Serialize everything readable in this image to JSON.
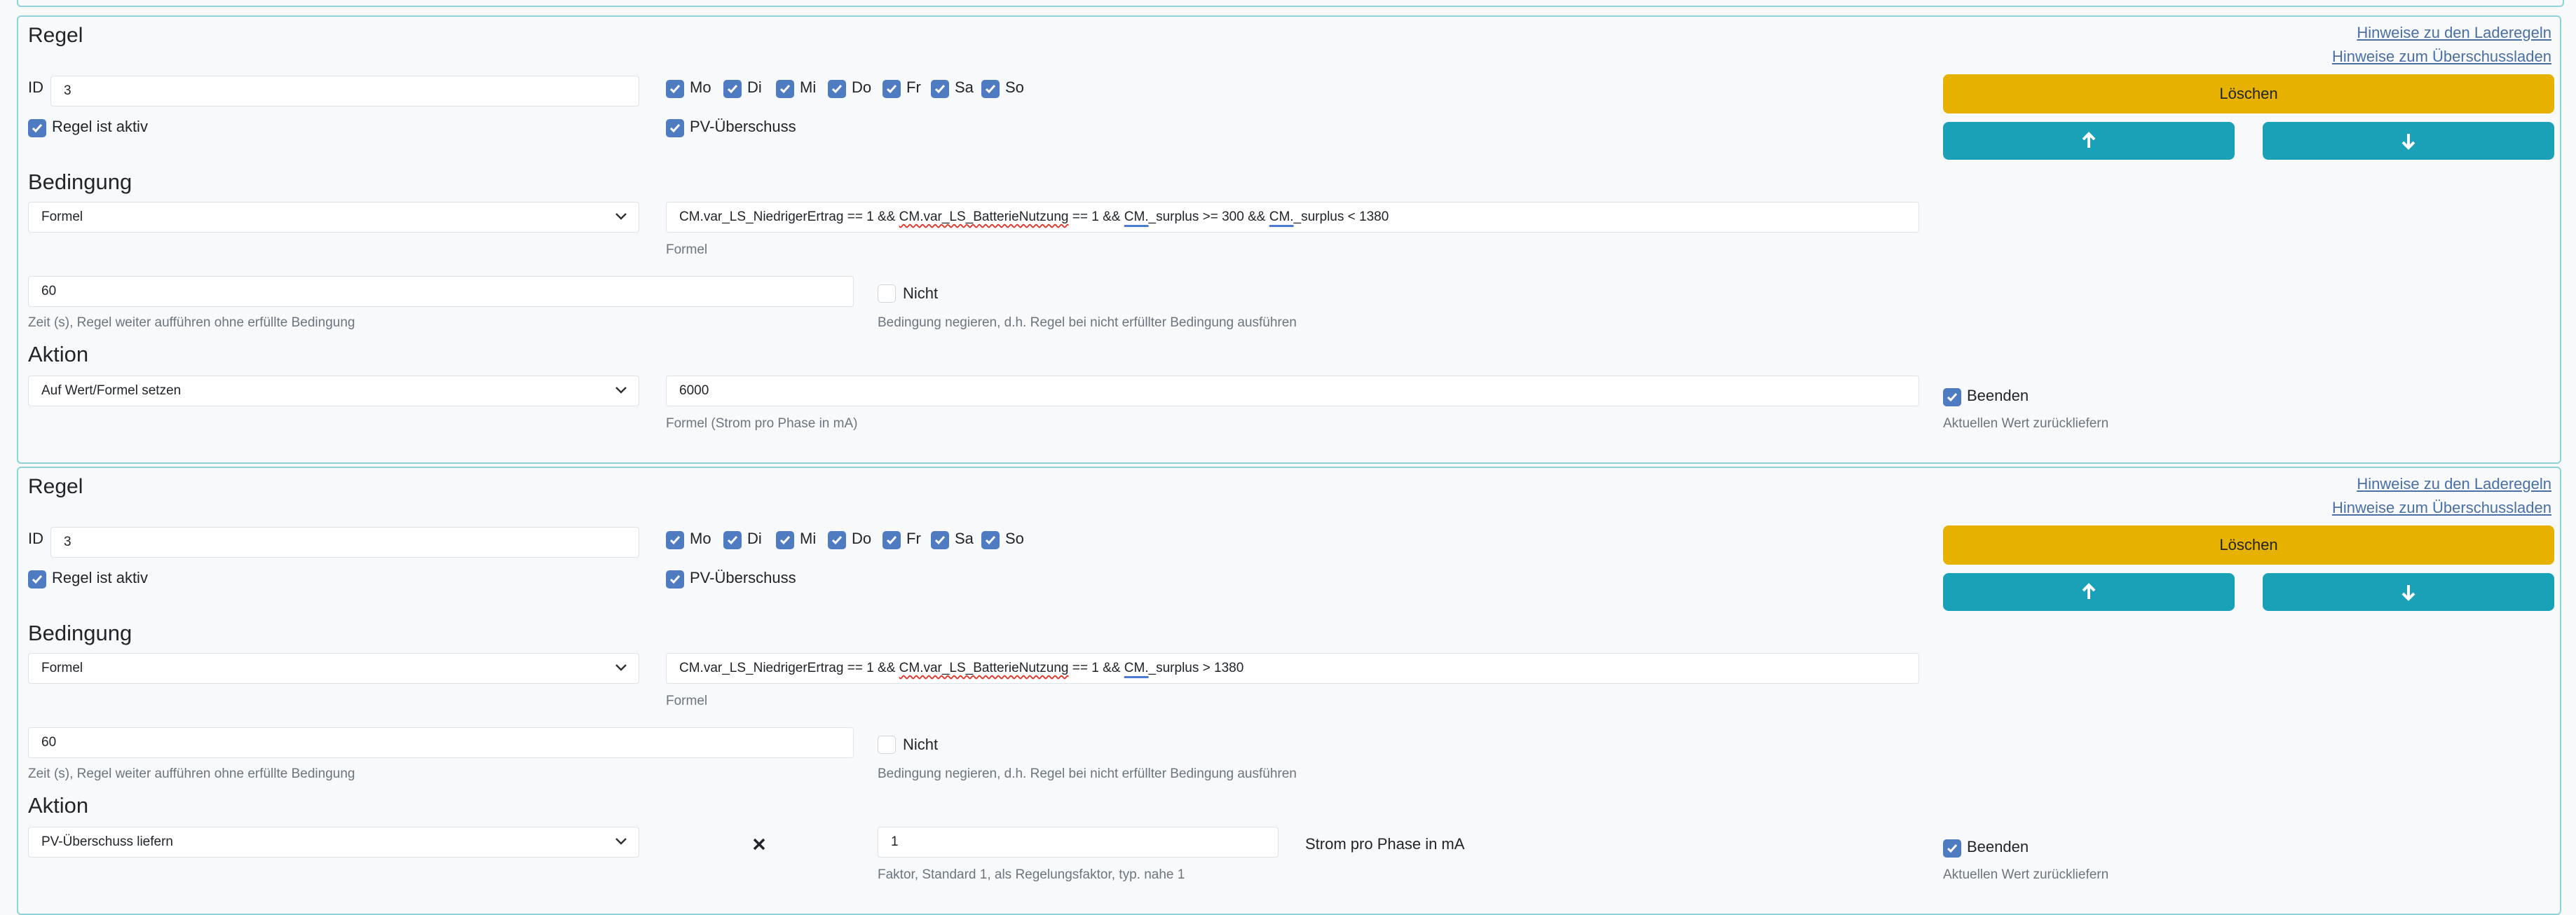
{
  "help_links": [
    "Hinweise zu den Laderegeln",
    "Hinweise zum Überschussladen"
  ],
  "rules": [
    {
      "title": "Regel",
      "id_label": "ID",
      "id_value": "3",
      "days": [
        {
          "label": "Mo",
          "checked": true
        },
        {
          "label": "Di",
          "checked": true
        },
        {
          "label": "Mi",
          "checked": true
        },
        {
          "label": "Do",
          "checked": true
        },
        {
          "label": "Fr",
          "checked": true
        },
        {
          "label": "Sa",
          "checked": true
        },
        {
          "label": "So",
          "checked": true
        }
      ],
      "active_label": "Regel ist aktiv",
      "pv_label": "PV-Überschuss",
      "delete_label": "Löschen",
      "condition_title": "Bedingung",
      "condition_type": "Formel",
      "formula_parts": [
        "CM.var_LS_NiedrigerErtrag == 1 && ",
        "CM.var_LS_BatterieNutzung",
        " == 1 && ",
        "CM.",
        "_surplus >= 300 && ",
        "CM.",
        "_surplus < 1380"
      ],
      "formula_help": "Formel",
      "time_value": "60",
      "time_help": "Zeit (s), Regel weiter aufführen ohne erfüllte Bedingung",
      "not_label": "Nicht",
      "not_help": "Bedingung negieren, d.h. Regel bei nicht erfüllter Bedingung ausführen",
      "action_title": "Aktion",
      "action_type": "Auf Wert/Formel setzen",
      "action_value": "6000",
      "action_help": "Formel (Strom pro Phase in mA)",
      "end_label": "Beenden",
      "end_help": "Aktuellen Wert zurückliefern"
    },
    {
      "title": "Regel",
      "id_label": "ID",
      "id_value": "3",
      "days": [
        {
          "label": "Mo",
          "checked": true
        },
        {
          "label": "Di",
          "checked": true
        },
        {
          "label": "Mi",
          "checked": true
        },
        {
          "label": "Do",
          "checked": true
        },
        {
          "label": "Fr",
          "checked": true
        },
        {
          "label": "Sa",
          "checked": true
        },
        {
          "label": "So",
          "checked": true
        }
      ],
      "active_label": "Regel ist aktiv",
      "pv_label": "PV-Überschuss",
      "delete_label": "Löschen",
      "condition_title": "Bedingung",
      "condition_type": "Formel",
      "formula_parts": [
        "CM.var_LS_NiedrigerErtrag == 1 && ",
        "CM.var_LS_BatterieNutzung",
        " == 1 && ",
        "CM.",
        "_surplus > 1380"
      ],
      "formula_help": "Formel",
      "time_value": "60",
      "time_help": "Zeit (s), Regel weiter aufführen ohne erfüllte Bedingung",
      "not_label": "Nicht",
      "not_help": "Bedingung negieren, d.h. Regel bei nicht erfüllter Bedingung ausführen",
      "action_title": "Aktion",
      "action_type": "PV-Überschuss liefern",
      "factor_value": "1",
      "factor_help": "Faktor, Standard 1, als Regelungsfaktor, typ. nahe 1",
      "unit_label": "Strom pro Phase in mA",
      "end_label": "Beenden",
      "end_help": "Aktuellen Wert zurückliefern"
    }
  ],
  "colors": {
    "accent": "#4f7cc0",
    "delete": "#e6b100",
    "arrows": "#1aa1b8",
    "border": "#8fd3d6"
  }
}
